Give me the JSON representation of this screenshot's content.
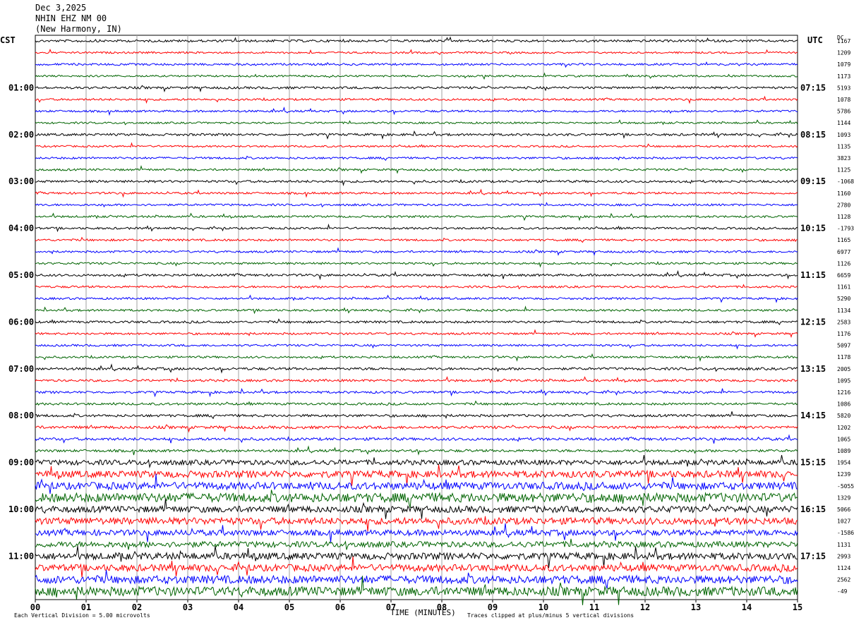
{
  "header": {
    "date": "Dec 3,2025",
    "station": "NHIN EHZ NM 00",
    "location": "(New Harmony, IN)"
  },
  "left_zone_label": "CST",
  "right_zone_label": "UTC",
  "dc_label": "DC",
  "footer": {
    "scale_note": "Each Vertical Division = 5.00 microvolts",
    "xlabel": "TIME (MINUTES)",
    "clip_note": "Traces clipped at plus/minus 5 vertical divisions"
  },
  "colors": {
    "trace_cycle": [
      "#000000",
      "#ff0000",
      "#0000ff",
      "#006400"
    ],
    "grid": "#a0a0a0"
  },
  "chart_data": {
    "type": "line",
    "subtype": "helicorder",
    "x_range_minutes": [
      0,
      15
    ],
    "x_ticks": [
      "00",
      "01",
      "02",
      "03",
      "04",
      "05",
      "06",
      "07",
      "08",
      "09",
      "10",
      "11",
      "12",
      "13",
      "14",
      "15"
    ],
    "rows_per_hour": 4,
    "row_count": 48,
    "left_hour_labels": [
      "01:00",
      "02:00",
      "03:00",
      "04:00",
      "05:00",
      "06:00",
      "07:00",
      "08:00",
      "09:00",
      "10:00",
      "11:00"
    ],
    "right_hour_labels": [
      "07:15",
      "08:15",
      "09:15",
      "10:15",
      "11:15",
      "12:15",
      "13:15",
      "14:15",
      "15:15",
      "16:15",
      "17:15"
    ],
    "dc_offsets": [
      "1167",
      "1209",
      "1079",
      "1173",
      "5193",
      "1078",
      "5786",
      "1144",
      "1093",
      "1135",
      "3823",
      "1125",
      "-1068",
      "1160",
      "2780",
      "1128",
      "-1793",
      "1165",
      "6977",
      "1126",
      "6659",
      "1161",
      "5290",
      "1134",
      "2583",
      "1176",
      "5097",
      "1178",
      "2005",
      "1095",
      "1216",
      "1086",
      "5820",
      "1202",
      "1065",
      "1089",
      "1954",
      "1239",
      "-5055",
      "1329",
      "5066",
      "1027",
      "-1586",
      "1131",
      "2993",
      "1124",
      "2562",
      "-49"
    ],
    "row_amplitude": [
      1,
      0.8,
      0.9,
      0.8,
      1,
      0.9,
      0.9,
      0.8,
      1,
      0.8,
      0.9,
      0.9,
      1,
      0.9,
      0.9,
      0.9,
      0.9,
      0.9,
      0.9,
      0.9,
      1,
      0.9,
      0.9,
      0.9,
      1,
      0.9,
      0.9,
      0.9,
      1.1,
      1,
      1,
      1,
      1.1,
      1.2,
      1.2,
      1.1,
      2.2,
      3,
      3.2,
      4,
      2.8,
      3,
      2.5,
      2.5,
      3,
      3,
      3.5,
      4
    ]
  }
}
